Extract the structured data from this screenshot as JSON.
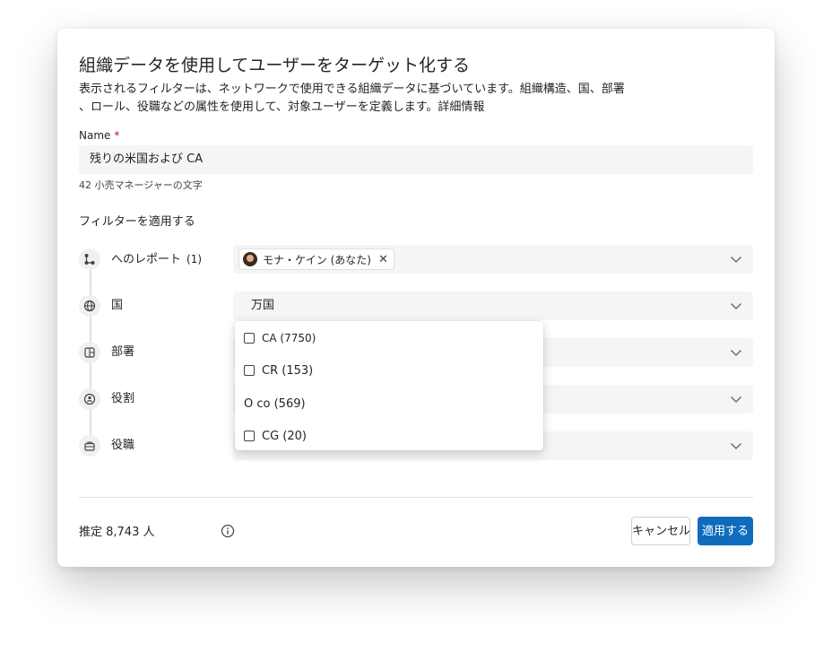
{
  "dialog": {
    "title": "組織データを使用してユーザーをターゲット化する",
    "description_line1": "表示されるフィルターは、ネットワークで使用できる組織データに基づいています。組織構造、国、部署",
    "description_line2": "、ロール、役職などの属性を使用して、対象ユーザーを定義します。詳細情報"
  },
  "name_field": {
    "label": "Name",
    "required_mark": "*",
    "value": "残りの米国および CA",
    "char_count": "42 小売マネージャーの文字"
  },
  "filters": {
    "heading": "フィルターを適用する",
    "rows": [
      {
        "label": "へのレポート",
        "count": "(1)",
        "icon": "org-chart-icon",
        "selected_chip": "モナ・ケイン (あなた)"
      },
      {
        "label": "国",
        "icon": "globe-icon",
        "value": "万国"
      },
      {
        "label": "部署",
        "icon": "department-icon"
      },
      {
        "label": "役割",
        "icon": "role-icon"
      },
      {
        "label": "役職",
        "icon": "job-title-icon"
      }
    ]
  },
  "country_dropdown": {
    "options": [
      {
        "label": "CA (7750)",
        "checkbox": true
      },
      {
        "label": "CR (153)",
        "checkbox": true
      },
      {
        "label": "O co (569)",
        "checkbox": false
      },
      {
        "label": "CG (20)",
        "checkbox": true
      }
    ]
  },
  "footer": {
    "estimate": "推定 8,743 人",
    "cancel_label": "キャンセル",
    "apply_label": "適用する"
  },
  "colors": {
    "accent": "#0f6cbd",
    "required": "#c50f1f",
    "field_bg": "#f5f5f5"
  }
}
